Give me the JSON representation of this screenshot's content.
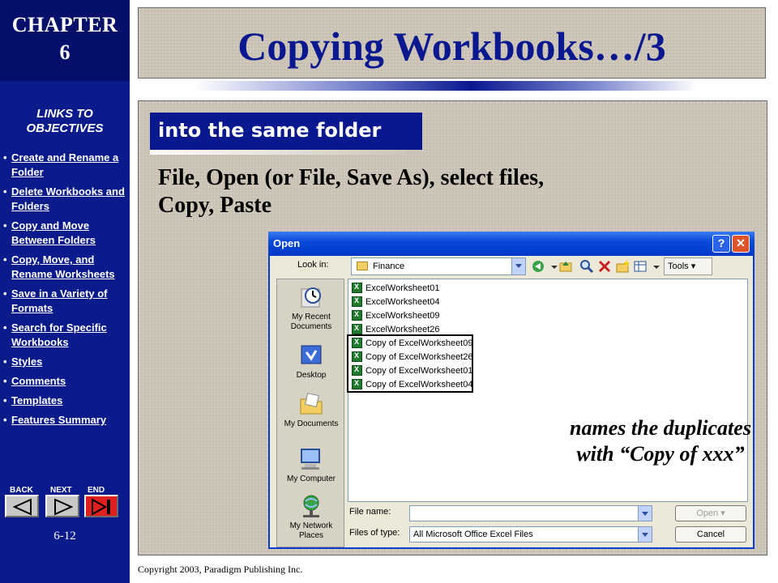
{
  "sidebar": {
    "chapter_label": "CHAPTER",
    "chapter_number": "6",
    "links_heading": "LINKS TO OBJECTIVES",
    "links": [
      "Create and Rename a Folder",
      "Delete Workbooks and Folders",
      "Copy and Move Between Folders",
      "Copy, Move, and Rename Worksheets",
      "Save in a Variety of Formats",
      "Search for Specific Workbooks",
      "Styles",
      "Comments",
      "Templates",
      "Features Summary"
    ],
    "nav": {
      "back": "BACK",
      "next": "NEXT",
      "end": "END"
    },
    "page_number": "6-12"
  },
  "slide": {
    "title": "Copying Workbooks…/3",
    "subheading": "into the same folder",
    "body_line1": "File, Open (or File, Save As), select files,",
    "body_line2": "Copy, Paste",
    "callout_line1": "names the duplicates",
    "callout_line2": "with “Copy of xxx”",
    "copyright": "Copyright 2003, Paradigm Publishing Inc."
  },
  "dialog": {
    "title": "Open",
    "help_glyph": "?",
    "close_glyph": "✕",
    "look_in_label": "Look in:",
    "look_in_value": "Finance",
    "tools_label": "Tools",
    "places": [
      "My Recent Documents",
      "Desktop",
      "My Documents",
      "My Computer",
      "My Network Places"
    ],
    "files": [
      "ExcelWorksheet01",
      "ExcelWorksheet04",
      "ExcelWorksheet09",
      "ExcelWorksheet26",
      "Copy of ExcelWorksheet09",
      "Copy of ExcelWorksheet26",
      "Copy of ExcelWorksheet01",
      "Copy of ExcelWorksheet04"
    ],
    "file_name_label": "File name:",
    "file_name_value": "",
    "files_of_type_label": "Files of type:",
    "files_of_type_value": "All Microsoft Office Excel Files",
    "open_button": "Open",
    "cancel_button": "Cancel"
  },
  "colors": {
    "sidebar": "#0b1b8c",
    "title": "#0a1890",
    "accent_red": "#e02020"
  }
}
